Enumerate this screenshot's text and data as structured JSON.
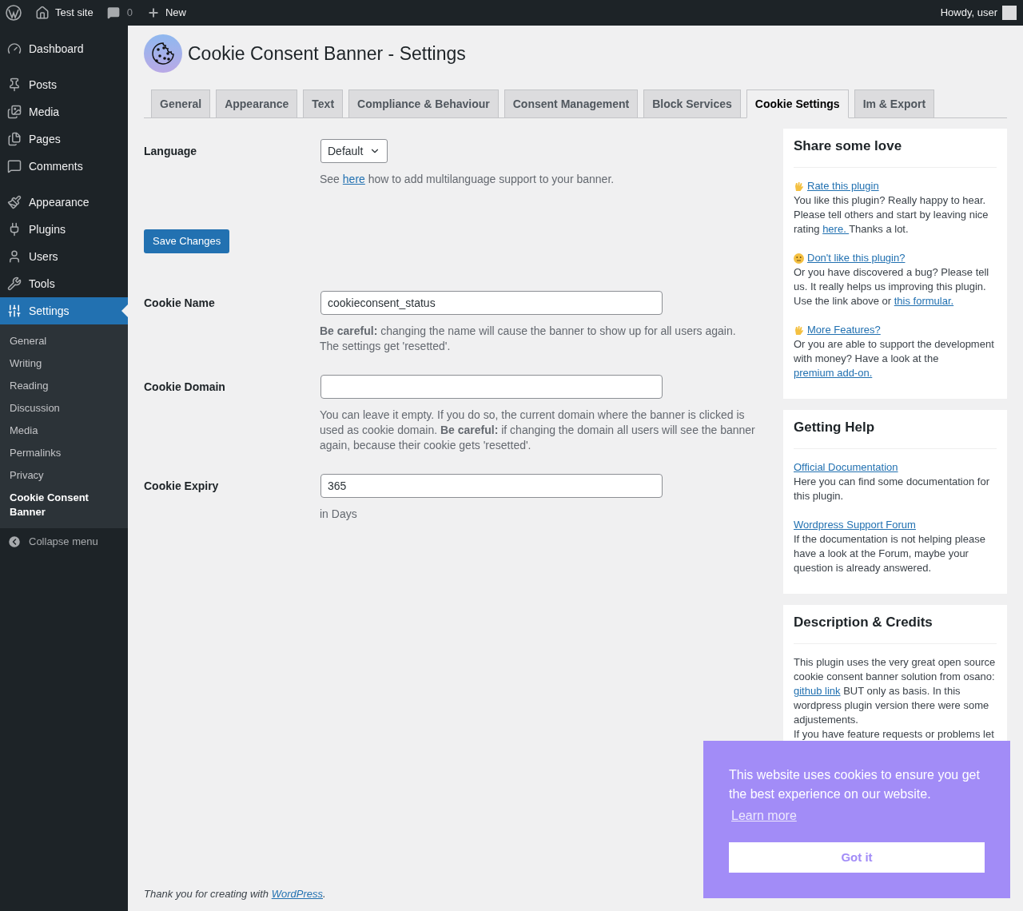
{
  "admin_bar": {
    "site_name": "Test site",
    "comments_count": "0",
    "new_label": "New",
    "greeting": "Howdy, user"
  },
  "menu_groups": [
    [
      {
        "label": "Dashboard",
        "selected": false
      }
    ],
    [
      {
        "label": "Posts",
        "selected": false
      },
      {
        "label": "Media",
        "selected": false
      },
      {
        "label": "Pages",
        "selected": false
      },
      {
        "label": "Comments",
        "selected": false
      }
    ],
    [
      {
        "label": "Appearance",
        "selected": false
      },
      {
        "label": "Plugins",
        "selected": false
      },
      {
        "label": "Users",
        "selected": false
      },
      {
        "label": "Tools",
        "selected": false
      },
      {
        "label": "Settings",
        "selected": true
      }
    ]
  ],
  "submenu": [
    {
      "label": "General",
      "selected": false
    },
    {
      "label": "Writing",
      "selected": false
    },
    {
      "label": "Reading",
      "selected": false
    },
    {
      "label": "Discussion",
      "selected": false
    },
    {
      "label": "Media",
      "selected": false
    },
    {
      "label": "Permalinks",
      "selected": false
    },
    {
      "label": "Privacy",
      "selected": false
    },
    {
      "label": "Cookie Consent Banner",
      "selected": true
    }
  ],
  "collapse_label": "Collapse menu",
  "page_title": "Cookie Consent Banner - Settings",
  "tabs": [
    {
      "label": "General",
      "selected": false
    },
    {
      "label": "Appearance",
      "selected": false
    },
    {
      "label": "Text",
      "selected": false
    },
    {
      "label": "Compliance & Behaviour",
      "selected": false
    },
    {
      "label": "Consent Management",
      "selected": false
    },
    {
      "label": "Block Services",
      "selected": false
    },
    {
      "label": "Cookie Settings",
      "selected": true
    },
    {
      "label": "Im & Export",
      "selected": false
    }
  ],
  "fields": [
    {
      "kind": "select",
      "label": "Language",
      "value": "Default",
      "help": [
        [
          {
            "text": "See "
          },
          {
            "link": "here"
          },
          {
            "text": " how to add multilanguage support to your banner."
          }
        ]
      ]
    },
    {
      "kind": "button",
      "label": "Save Changes"
    },
    {
      "kind": "text",
      "label": "Cookie Name",
      "value": "cookieconsent_status",
      "help": [
        [
          {
            "text": "**Be careful:** changing the name will cause the banner to show up for all users again."
          }
        ],
        [
          {
            "text": "The settings get 'resetted'."
          }
        ]
      ]
    },
    {
      "kind": "text",
      "label": "Cookie Domain",
      "help": [
        [
          {
            "text": "You can leave it empty. If you do so, the current domain where the banner is clicked is used as cookie domain. **Be careful:** if changing the domain all users will see the banner again, because their cookie gets 'resetted'."
          }
        ]
      ]
    },
    {
      "kind": "text",
      "label": "Cookie Expiry",
      "value": "365",
      "help": [
        [
          {
            "text": "in Days"
          }
        ]
      ]
    }
  ],
  "boxes": [
    {
      "kind": "love",
      "title": "Share some love",
      "sections": [
        {
          "heading_link": "Rate this plugin",
          "body": [
            {
              "text": "You like this plugin? Really happy to hear. Please tell others and start by leaving nice rating "
            },
            {
              "link": "here. "
            },
            {
              "text": "Thanks a lot."
            }
          ]
        },
        {
          "heading_link": "Don't like this plugin?",
          "body": [
            {
              "text": "Or you have discovered a bug? Please tell us. It really helps us improving this plugin. Use the link above or "
            },
            {
              "link": "this formular."
            }
          ]
        },
        {
          "heading_link": "More Features?",
          "body": [
            {
              "text": "Or you are able to support the development with money? Have a look at the "
            },
            {
              "link": "premium add-on."
            }
          ]
        }
      ]
    },
    {
      "kind": "help",
      "title": "Getting Help",
      "sections": [
        {
          "heading_link": "Official Documentation",
          "body": [
            {
              "text": "Here you can find some documentation for this plugin."
            }
          ]
        },
        {
          "heading_link": "Wordpress Support Forum",
          "body": [
            {
              "text": "If the documentation is not helping please have a look at the Forum, maybe your question is already answered."
            }
          ]
        }
      ]
    },
    {
      "kind": "credits",
      "title": "Description & Credits",
      "paragraphs": [
        [
          {
            "text": "This plugin uses the very great open source cookie consent banner solution from osano: "
          },
          {
            "link": "github link"
          },
          {
            "text": " BUT only as basis. In this wordpress plugin version there were some adjustements."
          }
        ],
        [
          {
            "text": "If you have feature requests or problems let"
          }
        ]
      ]
    }
  ],
  "footer": {
    "text_before": "Thank you for creating with ",
    "link": "WordPress",
    "text_after": "."
  },
  "cookie_banner": {
    "message": "This website uses cookies to ensure you get the best experience on our website.",
    "link": "Learn more",
    "button": "Got it"
  }
}
